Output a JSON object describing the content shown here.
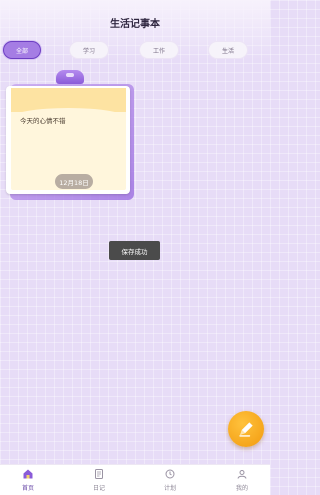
{
  "header": {
    "title": "生活记事本"
  },
  "tabs": [
    {
      "label": "全部",
      "active": true
    },
    {
      "label": "学习",
      "active": false
    },
    {
      "label": "工作",
      "active": false
    },
    {
      "label": "生活",
      "active": false
    }
  ],
  "note_card": {
    "text": "今天的心情不错",
    "date": "12月18日"
  },
  "toast": {
    "message": "保存成功"
  },
  "fab": {
    "icon": "edit-pencil-icon"
  },
  "bottom_nav": [
    {
      "label": "首页",
      "icon": "home-icon",
      "active": true
    },
    {
      "label": "日记",
      "icon": "diary-icon",
      "active": false
    },
    {
      "label": "计划",
      "icon": "plan-icon",
      "active": false
    },
    {
      "label": "我的",
      "icon": "profile-icon",
      "active": false
    }
  ],
  "colors": {
    "accent": "#a57de4",
    "background": "#e7dcf7",
    "fab": "#f5a623",
    "note": "#fff6dc"
  }
}
